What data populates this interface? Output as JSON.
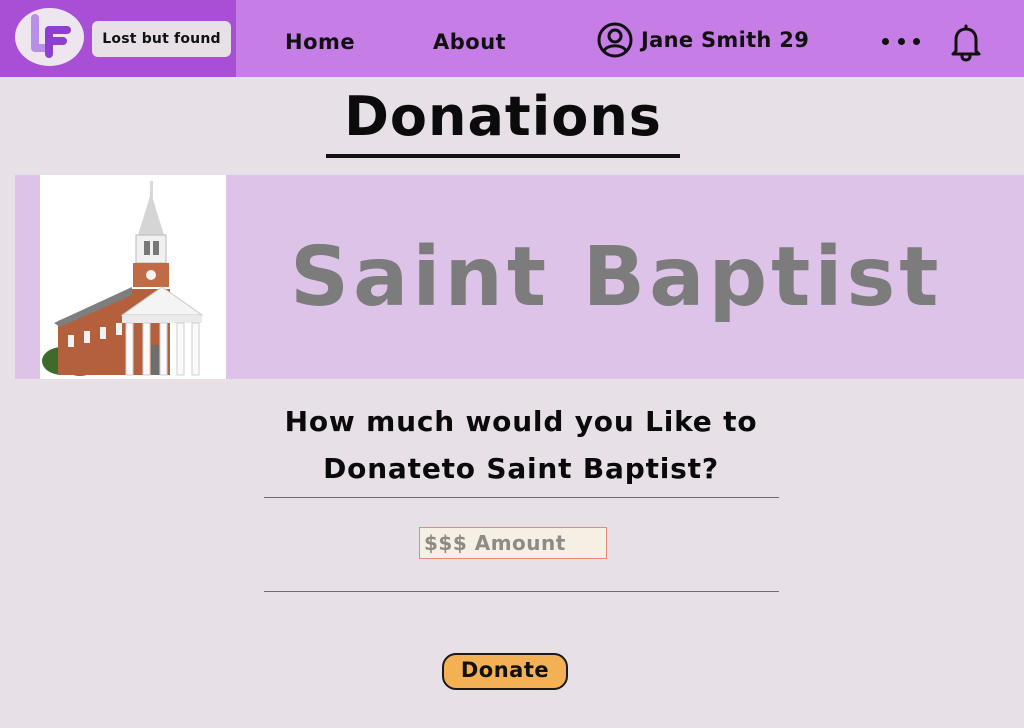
{
  "header": {
    "brand_name": "Lost but found",
    "logo_text": "LF",
    "nav": {
      "home": "Home",
      "about": "About"
    },
    "user": {
      "name": "Jane Smith 29",
      "icon": "user-circle-icon"
    },
    "more_icon": "more-dots-icon",
    "notification_icon": "bell-icon"
  },
  "page": {
    "title": "Donations"
  },
  "banner": {
    "organization": "Saint Baptist",
    "image": "church-photo"
  },
  "donation_form": {
    "question_line1": "How much would you Like to",
    "question_line2": "Donateto Saint Baptist?",
    "amount_placeholder": "$$$ Amount",
    "amount_value": "",
    "donate_label": "Donate"
  },
  "colors": {
    "header_bg": "#c67de6",
    "brand_bg": "#a94fd6",
    "page_bg": "#e7e0e6",
    "banner_bg": "#dec3e8",
    "banner_text": "#7c7c7c",
    "button_bg": "#f4b054",
    "logo_purple": "#b06fe0"
  }
}
